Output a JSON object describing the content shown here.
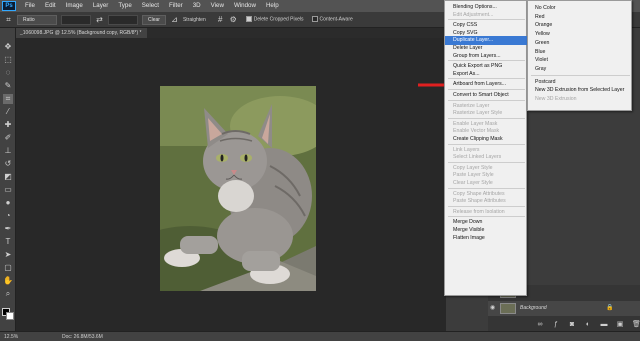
{
  "menubar": {
    "logo": "Ps",
    "items": [
      "File",
      "Edit",
      "Image",
      "Layer",
      "Type",
      "Select",
      "Filter",
      "3D",
      "View",
      "Window",
      "Help"
    ]
  },
  "options": {
    "ratio_label": "Ratio",
    "clear_label": "Clear",
    "straighten_label": "Straighten",
    "delete_cropped_label": "Delete Cropped Pixels",
    "content_aware_label": "Content-Aware",
    "delete_cropped_checked": true,
    "content_aware_checked": false
  },
  "document": {
    "tab_title": "_1060098.JPG @ 12.5% (Background copy, RGB/8*) *"
  },
  "status": {
    "zoom": "12.5%",
    "doc_info": "Doc: 26.8M/53.6M"
  },
  "context_menu": {
    "items": [
      {
        "label": "Blending Options...",
        "disabled": false
      },
      {
        "label": "Edit Adjustment...",
        "disabled": true
      },
      {
        "sep": true
      },
      {
        "label": "Copy CSS",
        "disabled": false
      },
      {
        "label": "Copy SVG",
        "disabled": false
      },
      {
        "label": "Duplicate Layer...",
        "disabled": false,
        "highlighted": true
      },
      {
        "label": "Delete Layer",
        "disabled": false
      },
      {
        "label": "Group from Layers...",
        "disabled": false
      },
      {
        "sep": true
      },
      {
        "label": "Quick Export as PNG",
        "disabled": false
      },
      {
        "label": "Export As...",
        "disabled": false
      },
      {
        "sep": true
      },
      {
        "label": "Artboard from Layers...",
        "disabled": false
      },
      {
        "sep": true
      },
      {
        "label": "Convert to Smart Object",
        "disabled": false
      },
      {
        "sep": true
      },
      {
        "label": "Rasterize Layer",
        "disabled": true
      },
      {
        "label": "Rasterize Layer Style",
        "disabled": true
      },
      {
        "sep": true
      },
      {
        "label": "Enable Layer Mask",
        "disabled": true
      },
      {
        "label": "Enable Vector Mask",
        "disabled": true
      },
      {
        "label": "Create Clipping Mask",
        "disabled": false
      },
      {
        "sep": true
      },
      {
        "label": "Link Layers",
        "disabled": true
      },
      {
        "label": "Select Linked Layers",
        "disabled": true
      },
      {
        "sep": true
      },
      {
        "label": "Copy Layer Style",
        "disabled": true
      },
      {
        "label": "Paste Layer Style",
        "disabled": true
      },
      {
        "label": "Clear Layer Style",
        "disabled": true
      },
      {
        "sep": true
      },
      {
        "label": "Copy Shape Attributes",
        "disabled": true
      },
      {
        "label": "Paste Shape Attributes",
        "disabled": true
      },
      {
        "sep": true
      },
      {
        "label": "Release from Isolation",
        "disabled": true
      },
      {
        "sep": true
      },
      {
        "label": "Merge Down",
        "disabled": false
      },
      {
        "label": "Merge Visible",
        "disabled": false
      },
      {
        "label": "Flatten Image",
        "disabled": false
      }
    ]
  },
  "color_submenu": {
    "items": [
      {
        "label": "No Color",
        "disabled": false
      },
      {
        "label": "Red",
        "disabled": false
      },
      {
        "label": "Orange",
        "disabled": false
      },
      {
        "label": "Yellow",
        "disabled": false
      },
      {
        "label": "Green",
        "disabled": false
      },
      {
        "label": "Blue",
        "disabled": false
      },
      {
        "label": "Violet",
        "disabled": false
      },
      {
        "label": "Gray",
        "disabled": false
      },
      {
        "sep": true
      },
      {
        "label": "Postcard",
        "disabled": false
      },
      {
        "label": "New 3D Extrusion from Selected Layer",
        "disabled": false
      },
      {
        "label": "New 3D Extrusion",
        "disabled": true
      }
    ]
  },
  "layers": {
    "rows": [
      {
        "name": "",
        "selected": false
      },
      {
        "name": "Background",
        "selected": true
      }
    ]
  },
  "colors": {
    "highlight": "#3a79d3",
    "annotation_arrow": "#e02020",
    "foreground": "#000000",
    "background": "#ffffff"
  }
}
